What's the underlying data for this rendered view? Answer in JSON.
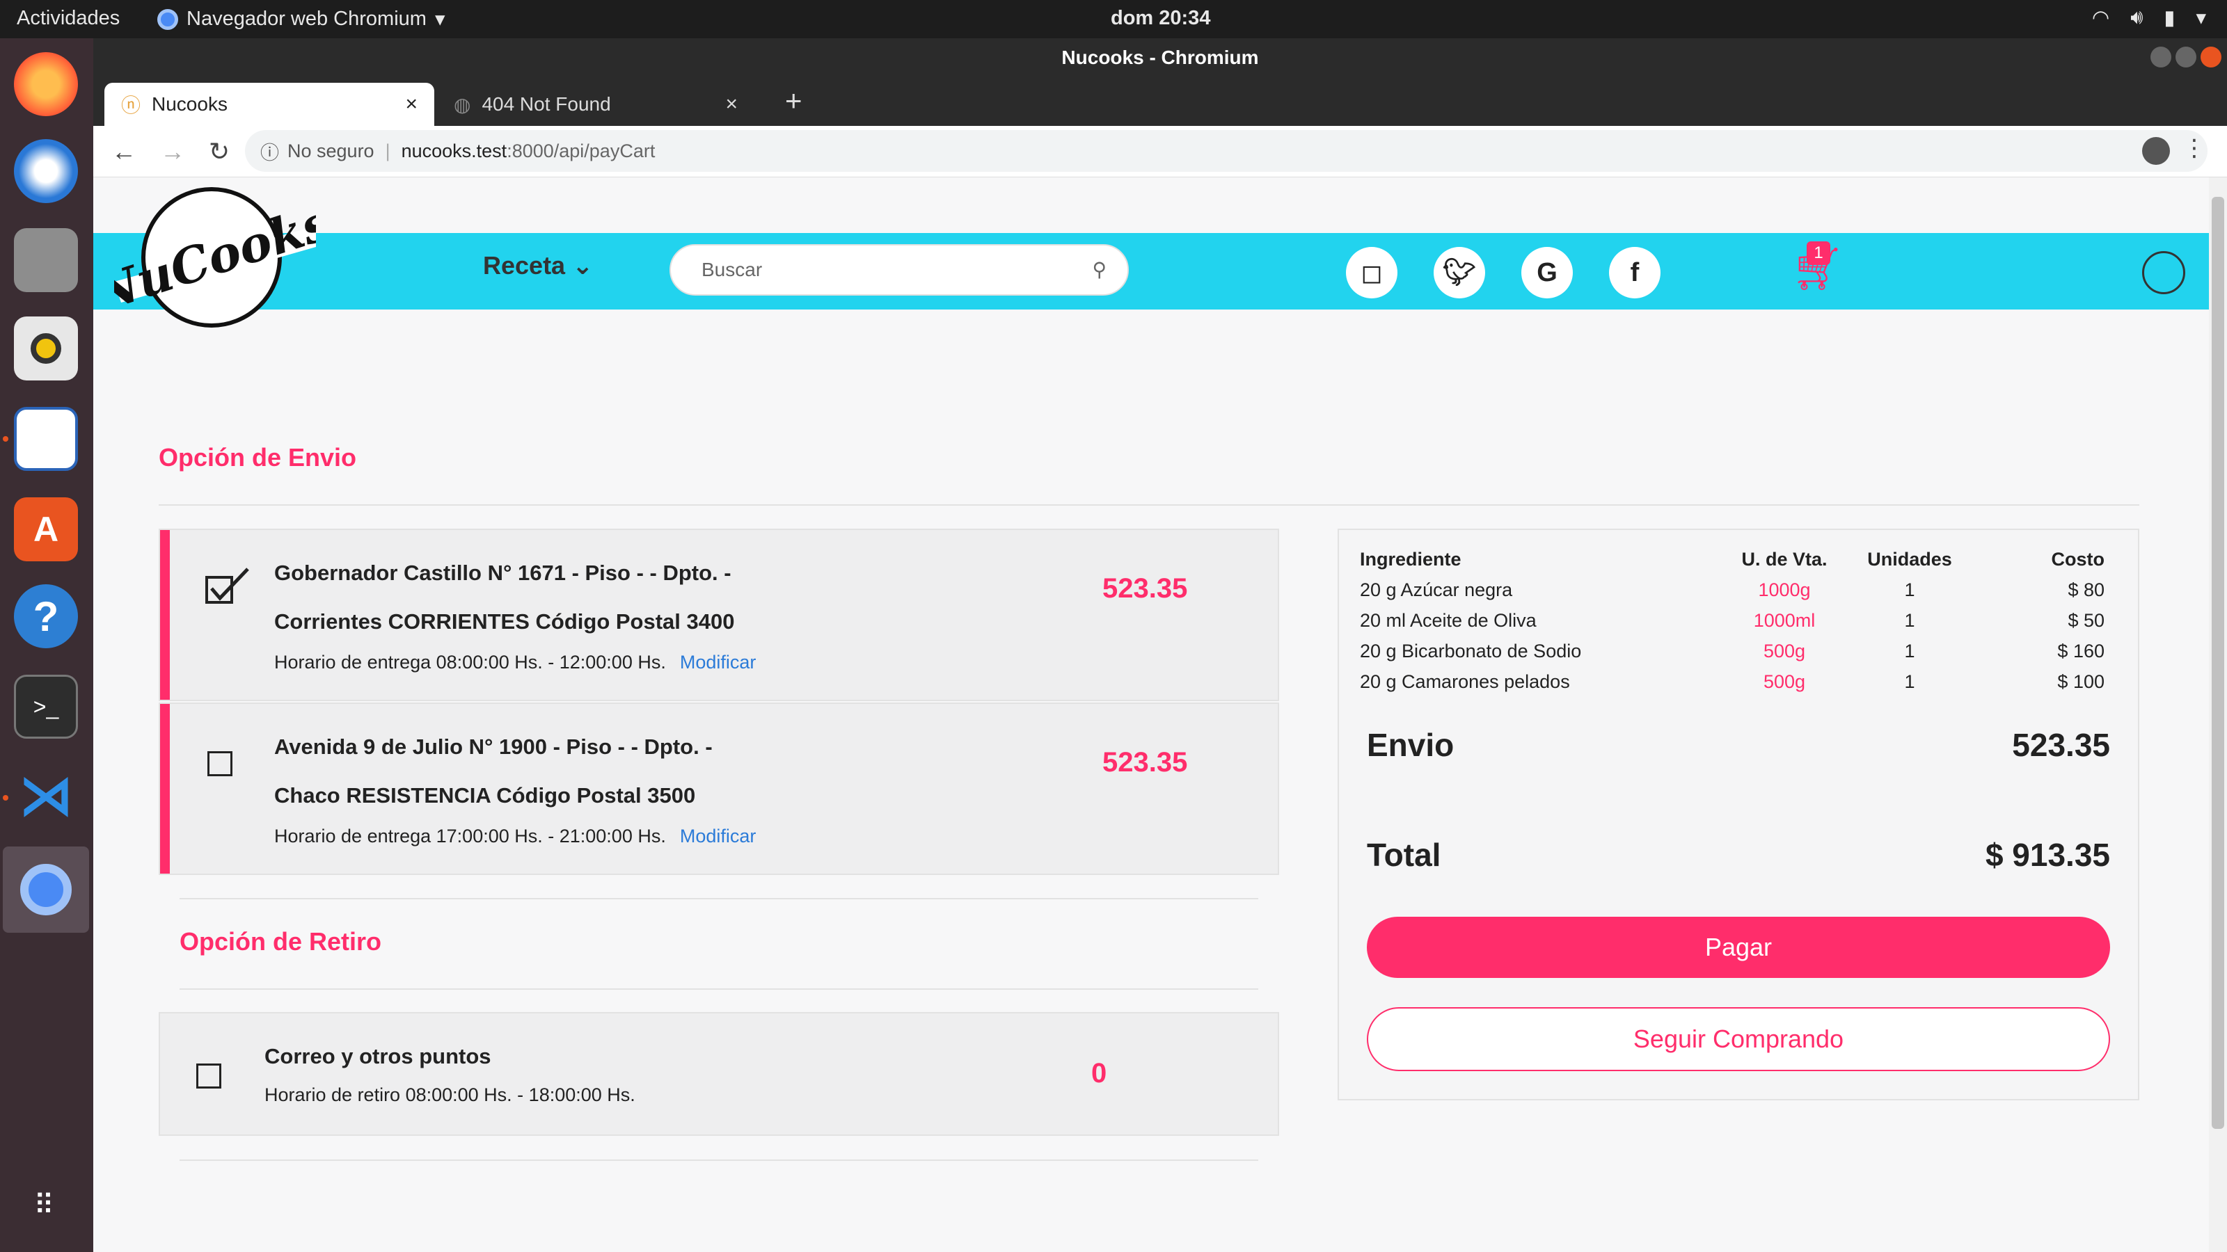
{
  "topbar": {
    "activities": "Actividades",
    "app_name": "Navegador web Chromium",
    "clock": "dom 20:34"
  },
  "window": {
    "title": "Nucooks - Chromium"
  },
  "tabs": [
    {
      "label": "Nucooks",
      "close": "×"
    },
    {
      "label": "404 Not Found",
      "close": "×"
    }
  ],
  "new_tab": "+",
  "address_bar": {
    "security": "No seguro",
    "separator": "|",
    "host": "nucooks.test",
    "path": ":8000/api/payCart"
  },
  "site": {
    "logo_text": "NuCooks",
    "menu_receta": "Receta",
    "search_placeholder": "Buscar",
    "cart_count": "1",
    "brand_color": "#ff2d6b",
    "header_color": "#22d3ee"
  },
  "envio": {
    "title": "Opción de Envio",
    "options": [
      {
        "line1": "Gobernador Castillo N° 1671 - Piso - - Dpto. -",
        "line2": "Corrientes CORRIENTES Código Postal 3400",
        "schedule": "Horario de entrega 08:00:00 Hs. - 12:00:00 Hs.",
        "modify": "Modificar",
        "price": "523.35",
        "checked": true
      },
      {
        "line1": "Avenida 9 de Julio N° 1900 - Piso - - Dpto. -",
        "line2": "Chaco RESISTENCIA Código Postal 3500",
        "schedule": "Horario de entrega 17:00:00 Hs. - 21:00:00 Hs.",
        "modify": "Modificar",
        "price": "523.35",
        "checked": false
      }
    ]
  },
  "retiro": {
    "title": "Opción de Retiro",
    "option": {
      "name": "Correo y otros puntos",
      "schedule": "Horario de retiro 08:00:00 Hs. - 18:00:00 Hs.",
      "price": "0"
    }
  },
  "summary": {
    "headers": [
      "Ingrediente",
      "U. de Vta.",
      "Unidades",
      "Costo"
    ],
    "rows": [
      [
        "20 g Azúcar negra",
        "1000g",
        "1",
        "$ 80"
      ],
      [
        "20 ml Aceite de Oliva",
        "1000ml",
        "1",
        "$ 50"
      ],
      [
        "20 g Bicarbonato de Sodio",
        "500g",
        "1",
        "$ 160"
      ],
      [
        "20 g Camarones pelados",
        "500g",
        "1",
        "$ 100"
      ]
    ],
    "envio_label": "Envio",
    "envio_value": "523.35",
    "total_label": "Total",
    "total_value": "$ 913.35",
    "pay_button": "Pagar",
    "keep_button": "Seguir Comprando"
  }
}
